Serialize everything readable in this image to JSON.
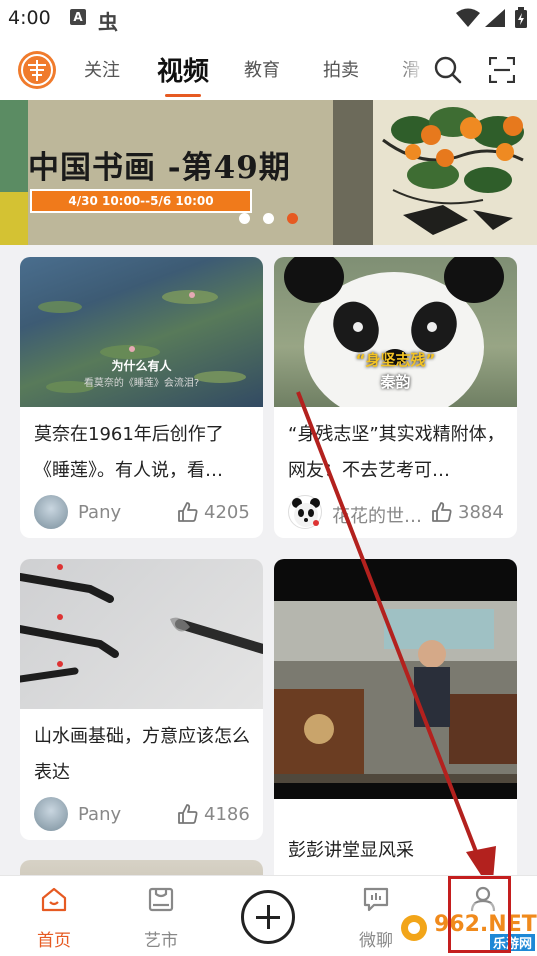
{
  "status_bar": {
    "time": "4:00",
    "a_icon_letter": "A",
    "bug_icon_glyph": "虫",
    "icons": [
      "wifi-icon",
      "signal-icon",
      "battery-icon"
    ]
  },
  "top_nav": {
    "tabs": [
      {
        "label": "关注",
        "active": false
      },
      {
        "label": "视频",
        "active": true
      },
      {
        "label": "教育",
        "active": false
      },
      {
        "label": "拍卖",
        "active": false
      },
      {
        "label": "滑",
        "active": false
      }
    ],
    "icons": [
      "search-icon",
      "scan-icon"
    ],
    "accent_color": "#e65a22"
  },
  "banner": {
    "title": "中国书画 -第49期",
    "date_range": "4/30 10:00--5/6 10:00",
    "page_count": 3,
    "active_index": 2
  },
  "cards": [
    {
      "title": "莫奈在1961年后创作了《睡莲》。有人说，看…",
      "overlay_line1": "为什么有人",
      "overlay_line2": "看莫奈的《睡莲》会流泪?",
      "author": "Pany",
      "likes": "4205"
    },
    {
      "title": "“身残志坚”其实戏精附体，网友：不去艺考可…",
      "overlay_line1": "“身坚志残”",
      "overlay_line2": "秦韵",
      "author": "花花的世…",
      "likes": "3884"
    },
    {
      "title": "山水画基础，方意应该怎么表达",
      "overlay_line1": "",
      "overlay_line2": "",
      "author": "Pany",
      "likes": "4186"
    },
    {
      "title": "彭彭讲堂显风采",
      "overlay_line1": "",
      "overlay_line2": "",
      "author": "",
      "likes": ""
    }
  ],
  "bottom_bar": {
    "items": [
      {
        "label": "首页",
        "icon": "home-icon",
        "active": true
      },
      {
        "label": "艺市",
        "icon": "market-icon",
        "active": false
      },
      {
        "label": "",
        "icon": "plus-icon",
        "active": false
      },
      {
        "label": "微聊",
        "icon": "chat-icon",
        "active": false
      },
      {
        "label": "",
        "icon": "profile-icon",
        "active": false
      }
    ]
  },
  "watermark": {
    "text_top": "962.NET",
    "text_bottom": "乐游网"
  },
  "colors": {
    "accent": "#e65a22",
    "annotation_red": "#c41e1e"
  }
}
